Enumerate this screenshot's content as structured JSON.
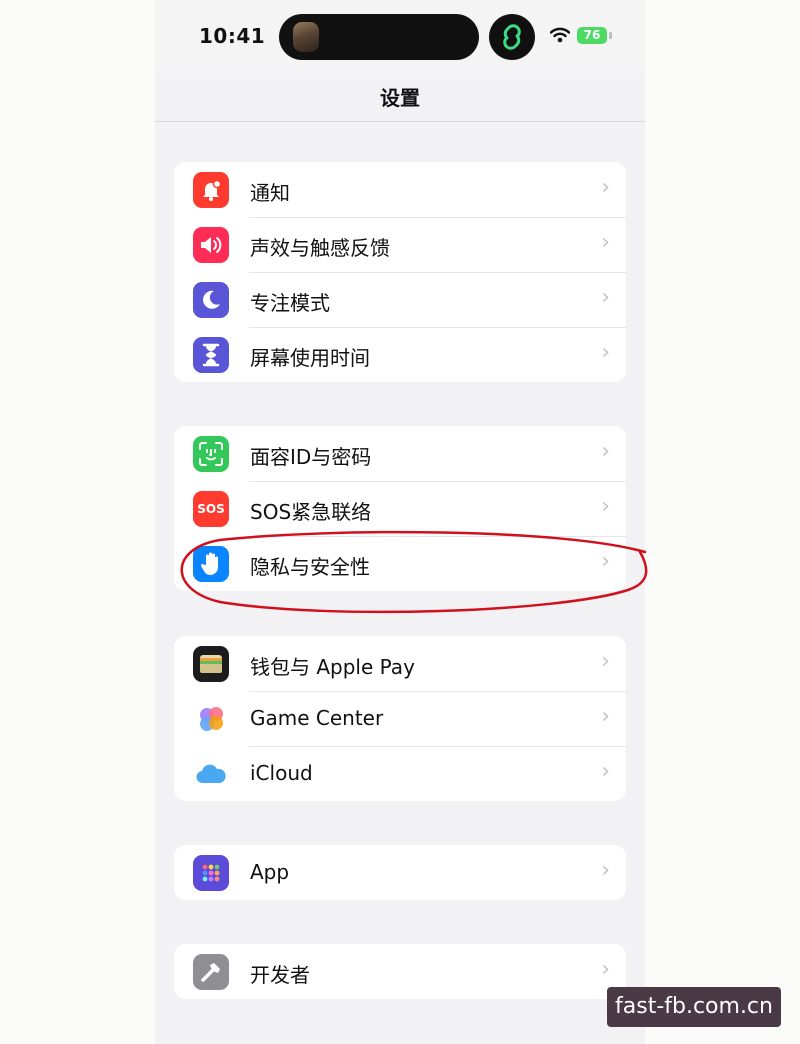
{
  "status_bar": {
    "time": "10:41",
    "battery": "76"
  },
  "nav": {
    "title": "设置"
  },
  "groups": [
    {
      "items": [
        {
          "label": "通知",
          "icon": "bell-badge-icon",
          "color": "#ff3b30"
        },
        {
          "label": "声效与触感反馈",
          "icon": "speaker-icon",
          "color": "#ff2d55"
        },
        {
          "label": "专注模式",
          "icon": "moon-icon",
          "color": "#5856d6"
        },
        {
          "label": "屏幕使用时间",
          "icon": "hourglass-icon",
          "color": "#5856d6"
        }
      ]
    },
    {
      "items": [
        {
          "label": "面容ID与密码",
          "icon": "face-id-icon",
          "color": "#34c759"
        },
        {
          "label": "SOS紧急联络",
          "icon": "sos-icon",
          "icon_text": "SOS",
          "color": "#ff3b30"
        },
        {
          "label": "隐私与安全性",
          "icon": "hand-icon",
          "color": "#0a84ff"
        }
      ]
    },
    {
      "items": [
        {
          "label": "钱包与 Apple Pay",
          "icon": "wallet-icon",
          "color": "#1c1c1e"
        },
        {
          "label": "Game Center",
          "icon": "game-center-icon",
          "color": "#ffffff"
        },
        {
          "label": "iCloud",
          "icon": "cloud-icon",
          "color": "#ffffff"
        }
      ]
    },
    {
      "items": [
        {
          "label": "App",
          "icon": "app-grid-icon",
          "color": "#5b4bd8"
        }
      ]
    },
    {
      "items": [
        {
          "label": "开发者",
          "icon": "hammer-icon",
          "color": "#8e8e93"
        }
      ]
    }
  ],
  "chevron": "›",
  "annotation_color": "#d0101c",
  "watermark": "fast-fb.com.cn"
}
